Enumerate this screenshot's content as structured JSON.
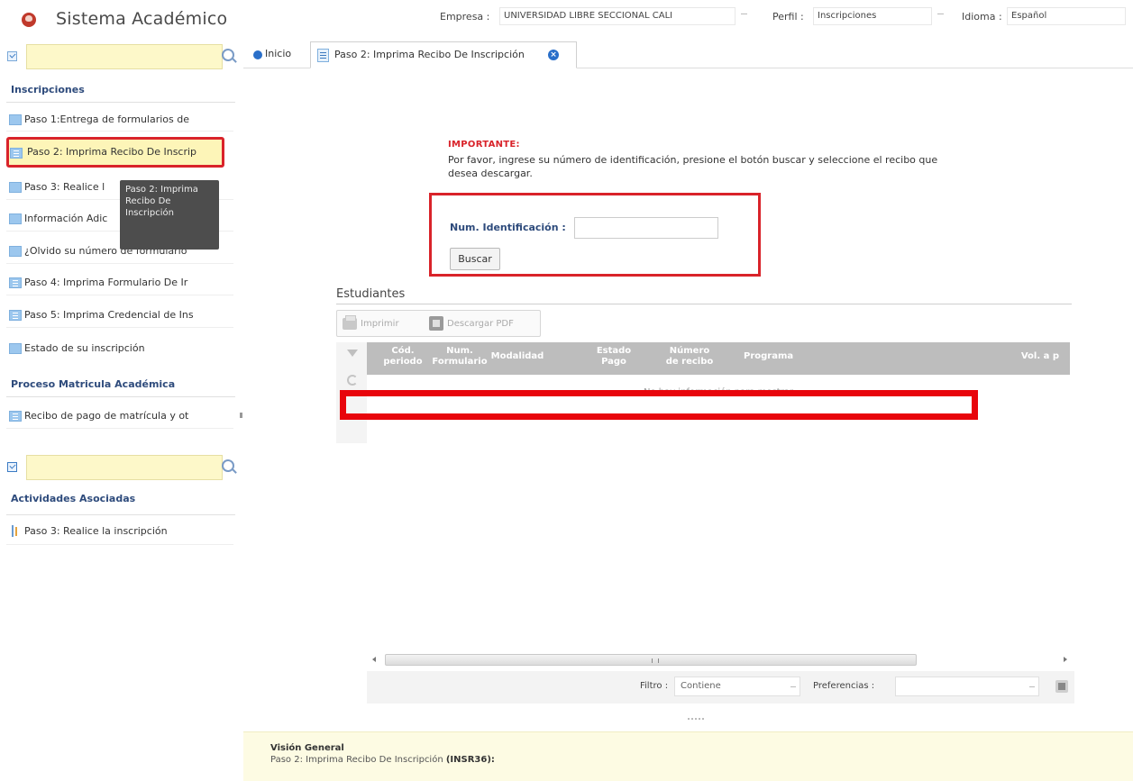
{
  "header": {
    "app_title": "Sistema Académico",
    "company_label": "Empresa :",
    "company_value": "UNIVERSIDAD LIBRE SECCIONAL CALI",
    "profile_label": "Perfil :",
    "profile_value": "Inscripciones",
    "language_label": "Idioma :",
    "language_value": "Español"
  },
  "sidebar": {
    "search_top_value": "",
    "section_1": "Inscripciones",
    "items": [
      "Paso 1:Entrega de formularios de",
      "Paso 2: Imprima Recibo De Inscrip",
      "Paso 3: Realice l",
      "Información Adic",
      "¿Olvido su número de formulario",
      "Paso 4: Imprima Formulario De Ir",
      "Paso 5: Imprima Credencial de Ins",
      "Estado de su inscripción"
    ],
    "section_2": "Proceso Matricula Académica",
    "items_2": [
      "Recibo de pago de matrícula y ot"
    ],
    "tooltip_text": "Paso 2: Imprima Recibo De Inscripción",
    "search_bottom_value": "",
    "section_3": "Actividades Asociadas",
    "activities": [
      "Paso 3: Realice la inscripción"
    ]
  },
  "tabs": {
    "home": "Inicio",
    "active": "Paso 2: Imprima Recibo De Inscripción"
  },
  "main": {
    "notice_title": "IMPORTANTE:",
    "notice_text": "Por favor, ingrese su número de identificación, presione el botón buscar y seleccione el recibo que desea descargar.",
    "id_label": "Num. Identificación :",
    "id_value": "",
    "search_button": "Buscar",
    "students_title": "Estudiantes",
    "toolbar_print": "Imprimir",
    "toolbar_pdf": "Descargar PDF",
    "columns": [
      "Cód. periodo",
      "Num. Formulario",
      "Modalidad",
      "Estado Pago",
      "Número de recibo",
      "Programa",
      "Vol. a p"
    ],
    "empty_message": "No hay información para mostrar",
    "filter_label": "Filtro :",
    "filter_value": "Contiene",
    "preferences_label": "Preferencias :",
    "preferences_value": ""
  },
  "footer": {
    "title": "Visión General",
    "subtitle": "Paso 2: Imprima Recibo De Inscripción",
    "code": "(INSR36):"
  },
  "colors": {
    "highlight_red": "#d9232a",
    "accent_blue": "#2a6fc9",
    "search_yellow": "#fdf8c9"
  }
}
